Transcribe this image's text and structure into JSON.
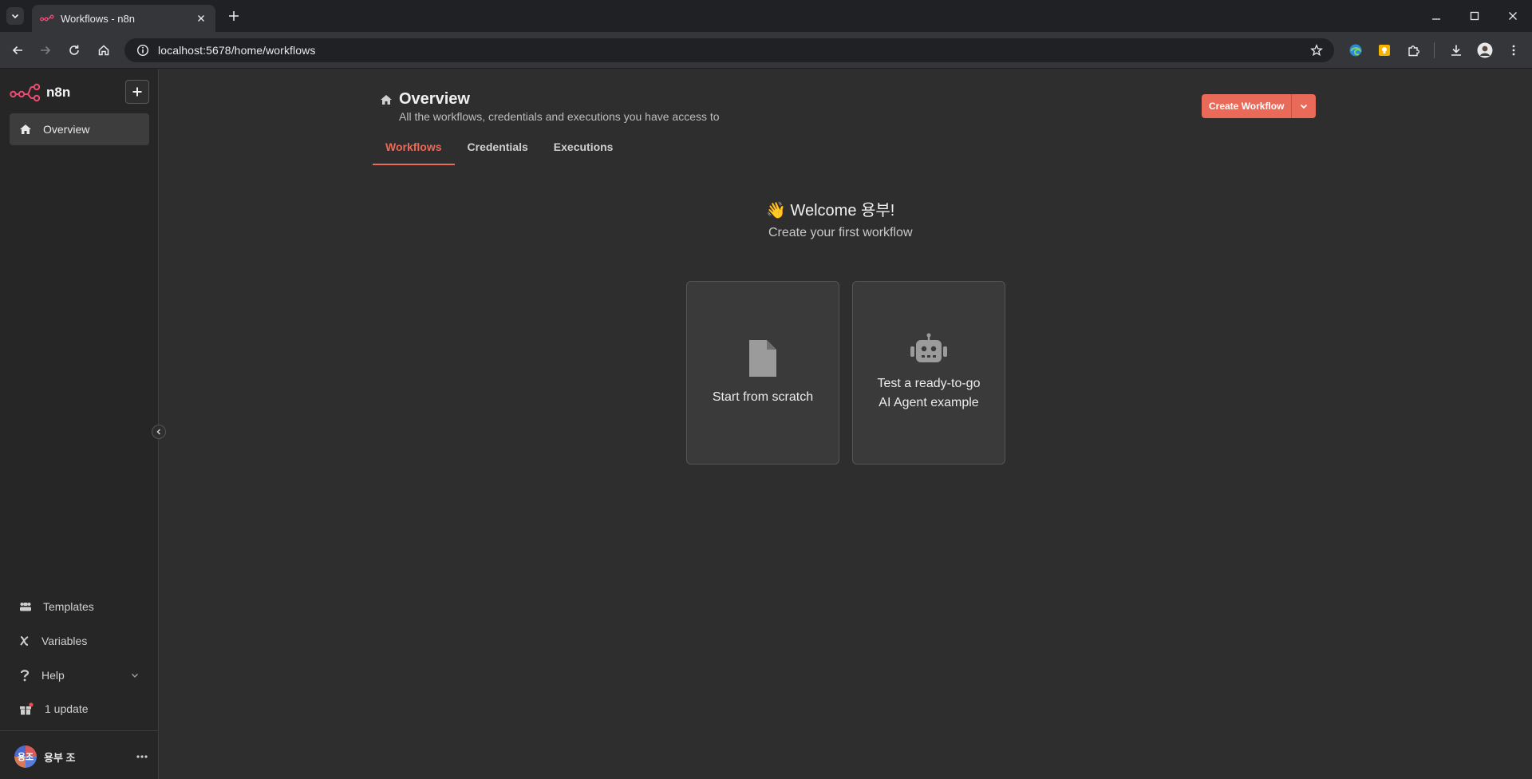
{
  "browser": {
    "tab_title": "Workflows - n8n",
    "url": "localhost:5678/home/workflows"
  },
  "sidebar": {
    "brand": "n8n",
    "active_item": "Overview",
    "bottom_items": [
      {
        "label": "Templates",
        "icon": "templates-icon"
      },
      {
        "label": "Variables",
        "icon": "variables-icon"
      },
      {
        "label": "Help",
        "icon": "help-icon"
      },
      {
        "label": "1 update",
        "icon": "gift-icon"
      }
    ],
    "user": {
      "initials": "용조",
      "name": "용부 조"
    }
  },
  "header": {
    "title": "Overview",
    "subtitle": "All the workflows, credentials and executions you have access to",
    "create_button": "Create Workflow"
  },
  "tabs": [
    "Workflows",
    "Credentials",
    "Executions"
  ],
  "welcome": {
    "title": "👋 Welcome 용부!",
    "subtitle": "Create your first workflow"
  },
  "cards": [
    {
      "label": "Start from scratch",
      "icon": "file-icon"
    },
    {
      "label_line1": "Test a ready-to-go",
      "label_line2": "AI Agent example",
      "icon": "robot-icon"
    }
  ],
  "colors": {
    "accent": "#ea6a5a",
    "background": "#2e2e2e",
    "sidebar": "#262626"
  }
}
